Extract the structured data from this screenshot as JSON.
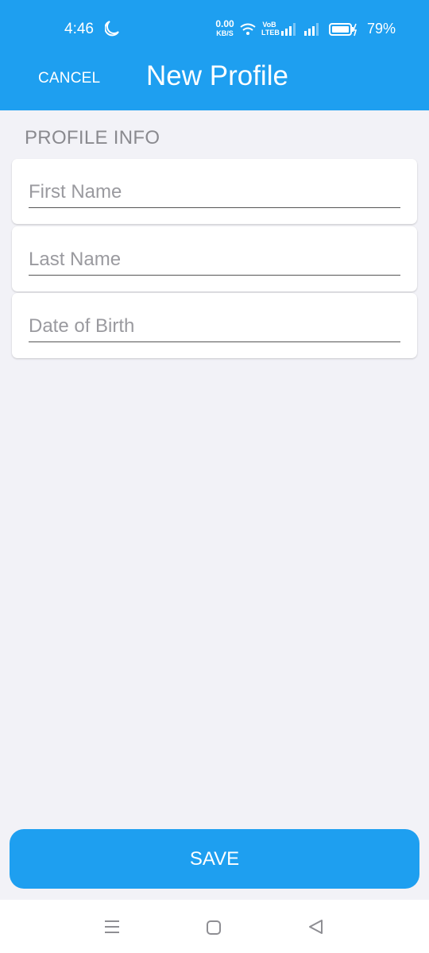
{
  "status_bar": {
    "time": "4:46",
    "net_speed_value": "0.00",
    "net_speed_unit": "KB/S",
    "volte_top": "VoB",
    "volte_bottom": "LTEB",
    "battery_percent": "79%"
  },
  "header": {
    "cancel_label": "CANCEL",
    "title": "New Profile"
  },
  "form": {
    "section_title": "PROFILE INFO",
    "fields": [
      {
        "placeholder": "First Name",
        "value": ""
      },
      {
        "placeholder": "Last Name",
        "value": ""
      },
      {
        "placeholder": "Date of Birth",
        "value": ""
      }
    ]
  },
  "footer": {
    "save_label": "SAVE"
  },
  "colors": {
    "accent": "#1e9ff0",
    "background": "#f2f2f7",
    "card": "#ffffff",
    "muted_text": "#8a8a8f"
  },
  "icons": {
    "status": [
      "moon-icon",
      "wifi-icon",
      "signal-icon",
      "signal-icon",
      "battery-charging-icon"
    ],
    "nav": [
      "menu-icon",
      "home-icon",
      "back-icon"
    ]
  }
}
